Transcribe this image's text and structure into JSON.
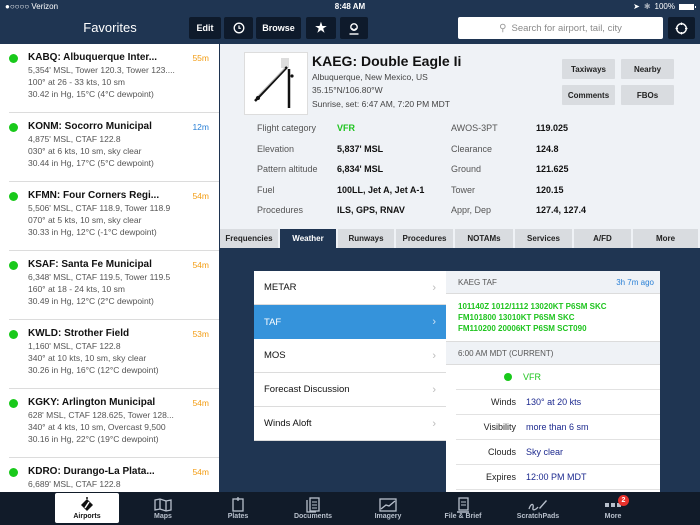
{
  "status_bar": {
    "carrier": "●○○○○ Verizon",
    "time": "8:48 AM",
    "battery": "100%"
  },
  "nav": {
    "title": "Favorites",
    "edit_label": "Edit",
    "browse_label": "Browse",
    "search_placeholder": "Search for airport, tail, city"
  },
  "favorites": [
    {
      "name": "KABQ: Albuquerque Inter...",
      "age": "55m",
      "age_color": "#f39c12",
      "lines": [
        "5,354' MSL, Tower 120.3, Tower 123....",
        "100° at 26 - 33 kts, 10 sm",
        "30.42 in Hg, 15°C (4°C dewpoint)"
      ]
    },
    {
      "name": "KONM: Socorro Municipal",
      "age": "12m",
      "age_color": "#2a80d6",
      "lines": [
        "4,875' MSL, CTAF 122.8",
        "030° at 6 kts, 10 sm, sky clear",
        "30.44 in Hg, 17°C (5°C dewpoint)"
      ]
    },
    {
      "name": "KFMN: Four Corners Regi...",
      "age": "54m",
      "age_color": "#f39c12",
      "lines": [
        "5,506' MSL, CTAF 118.9, Tower 118.9",
        "070° at 5 kts, 10 sm, sky clear",
        "30.33 in Hg, 12°C (-1°C dewpoint)"
      ]
    },
    {
      "name": "KSAF: Santa Fe Municipal",
      "age": "54m",
      "age_color": "#f39c12",
      "lines": [
        "6,348' MSL, CTAF 119.5, Tower 119.5",
        "160° at 18 - 24 kts, 10 sm",
        "30.49 in Hg, 12°C (2°C dewpoint)"
      ]
    },
    {
      "name": "KWLD: Strother Field",
      "age": "53m",
      "age_color": "#f39c12",
      "lines": [
        "1,160' MSL, CTAF 122.8",
        "340° at 10 kts, 10 sm, sky clear",
        "30.26 in Hg, 16°C (12°C dewpoint)"
      ]
    },
    {
      "name": "KGKY: Arlington Municipal",
      "age": "54m",
      "age_color": "#f39c12",
      "lines": [
        "628' MSL, CTAF 128.625, Tower 128...",
        "340° at 4 kts, 10 sm, Overcast 9,500",
        "30.16 in Hg, 22°C (19°C dewpoint)"
      ]
    },
    {
      "name": "KDRO: Durango-La Plata...",
      "age": "54m",
      "age_color": "#f39c12",
      "lines": [
        "6,689' MSL, CTAF 122.8",
        "",
        ""
      ]
    }
  ],
  "airport": {
    "title": "KAEG: Double Eagle Ii",
    "location": "Albuquerque, New Mexico, US",
    "coords": "35.15°N/106.80°W",
    "sun": "Sunrise, set: 6:47 AM, 7:20 PM MDT",
    "buttons": {
      "taxiways": "Taxiways",
      "nearby": "Nearby",
      "comments": "Comments",
      "fbos": "FBOs"
    },
    "left_info": [
      {
        "label": "Flight category",
        "value": "VFR",
        "color": "#1ec41e"
      },
      {
        "label": "Elevation",
        "value": "5,837' MSL",
        "color": "#111111"
      },
      {
        "label": "Pattern altitude",
        "value": "6,834' MSL",
        "color": "#111111"
      },
      {
        "label": "Fuel",
        "value": "100LL, Jet A, Jet A-1",
        "color": "#111111"
      },
      {
        "label": "Procedures",
        "value": "ILS, GPS, RNAV",
        "color": "#111111"
      }
    ],
    "right_info": [
      {
        "label": "AWOS-3PT",
        "value": "119.025"
      },
      {
        "label": "Clearance",
        "value": "124.8"
      },
      {
        "label": "Ground",
        "value": "121.625"
      },
      {
        "label": "Tower",
        "value": "120.15"
      },
      {
        "label": "Appr, Dep",
        "value": "127.4, 127.4"
      }
    ]
  },
  "tabs": [
    "Frequencies",
    "Weather",
    "Runways",
    "Procedures",
    "NOTAMs",
    "Services",
    "A/FD",
    "More"
  ],
  "active_tab": "Weather",
  "weather_menu": [
    "METAR",
    "TAF",
    "MOS",
    "Forecast Discussion",
    "Winds Aloft"
  ],
  "weather_active": "TAF",
  "taf": {
    "header": "KAEG TAF",
    "age": "3h 7m ago",
    "raw": [
      "101140Z 1012/1112 13020KT P6SM SKC",
      "FM101800 13010KT P6SM SKC",
      "FM110200 20006KT P6SM SCT090"
    ],
    "current_header": "6:00 AM MDT (CURRENT)",
    "category": "VFR",
    "rows": [
      {
        "label": "Winds",
        "value": "130° at 20 kts"
      },
      {
        "label": "Visibility",
        "value": "more than 6 sm"
      },
      {
        "label": "Clouds",
        "value": "Sky clear"
      },
      {
        "label": "Expires",
        "value": "12:00 PM MDT"
      }
    ]
  },
  "tabbar": [
    {
      "label": "Airports",
      "icon": "airport-icon"
    },
    {
      "label": "Maps",
      "icon": "map-icon"
    },
    {
      "label": "Plates",
      "icon": "plates-icon"
    },
    {
      "label": "Documents",
      "icon": "documents-icon"
    },
    {
      "label": "Imagery",
      "icon": "imagery-icon"
    },
    {
      "label": "File & Brief",
      "icon": "file-brief-icon"
    },
    {
      "label": "ScratchPads",
      "icon": "scratchpad-icon"
    },
    {
      "label": "More",
      "icon": "more-icon",
      "badge": "2"
    }
  ]
}
